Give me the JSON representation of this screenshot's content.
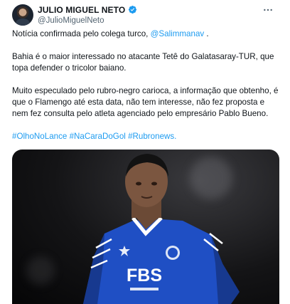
{
  "author": {
    "display_name": "JULIO MIGUEL NETO",
    "handle": "@JulioMiguelNeto",
    "verified": true
  },
  "tweet": {
    "line1_text": "Notícia confirmada pelo colega turco,",
    "line1_mention": "@Salimmanav",
    "line1_end": " .",
    "para2": "Bahia é o maior interessado no atacante Tetê do Galatasaray-TUR, que topa defender o tricolor baiano.",
    "para3": "Muito especulado pelo rubro-negro carioca, a informação  que obtenho, é que o Flamengo até esta data, não tem interesse, não fez proposta e nem fez consulta pelo atleta agenciado pelo empresário Pablo Bueno.",
    "hashtags": [
      "#OlhoNoLance",
      "#NaCaraDoGol",
      "#Rubronews."
    ]
  },
  "media": {
    "sponsor_text": "FBS",
    "description_icon": "player-photo"
  },
  "colors": {
    "link": "#1d9bf0",
    "verified": "#1d9bf0",
    "secondary_text": "#536471",
    "jersey": "#1f4fc4"
  }
}
